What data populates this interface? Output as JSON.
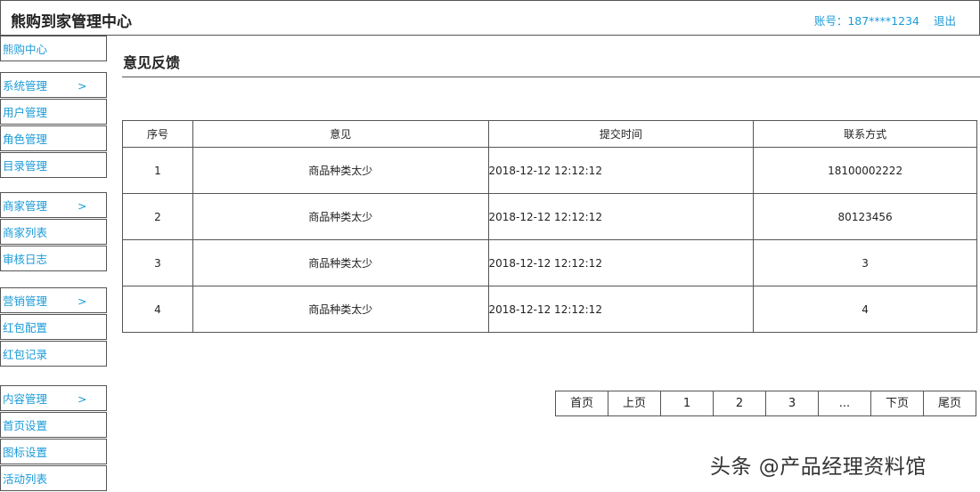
{
  "header": {
    "title": "熊购到家管理中心",
    "account_label": "账号：187****1234",
    "logout_label": "退出"
  },
  "sidebar": {
    "home": "熊购中心",
    "groups": [
      {
        "label": "系统管理",
        "arrow": ">",
        "items": [
          "用户管理",
          "角色管理",
          "目录管理"
        ]
      },
      {
        "label": "商家管理",
        "arrow": ">",
        "items": [
          "商家列表",
          "审核日志"
        ]
      },
      {
        "label": "营销管理",
        "arrow": ">",
        "items": [
          "红包配置",
          "红包记录"
        ]
      },
      {
        "label": "内容管理",
        "arrow": ">",
        "items": [
          "首页设置",
          "图标设置",
          "活动列表"
        ]
      }
    ]
  },
  "main": {
    "title": "意见反馈",
    "table": {
      "headers": [
        "序号",
        "意见",
        "提交时间",
        "联系方式"
      ],
      "rows": [
        [
          "1",
          "商品种类太少",
          "2018-12-12 12:12:12",
          "18100002222"
        ],
        [
          "2",
          "商品种类太少",
          "2018-12-12 12:12:12",
          "80123456"
        ],
        [
          "3",
          "商品种类太少",
          "2018-12-12 12:12:12",
          "3"
        ],
        [
          "4",
          "商品种类太少",
          "2018-12-12 12:12:12",
          "4"
        ]
      ]
    },
    "pager": [
      "首页",
      "上页",
      "1",
      "2",
      "3",
      "...",
      "下页",
      "尾页"
    ]
  },
  "watermark": "头条 @产品经理资料馆",
  "colors": {
    "accent": "#1a9bd8",
    "border": "#555555",
    "text": "#222222"
  }
}
